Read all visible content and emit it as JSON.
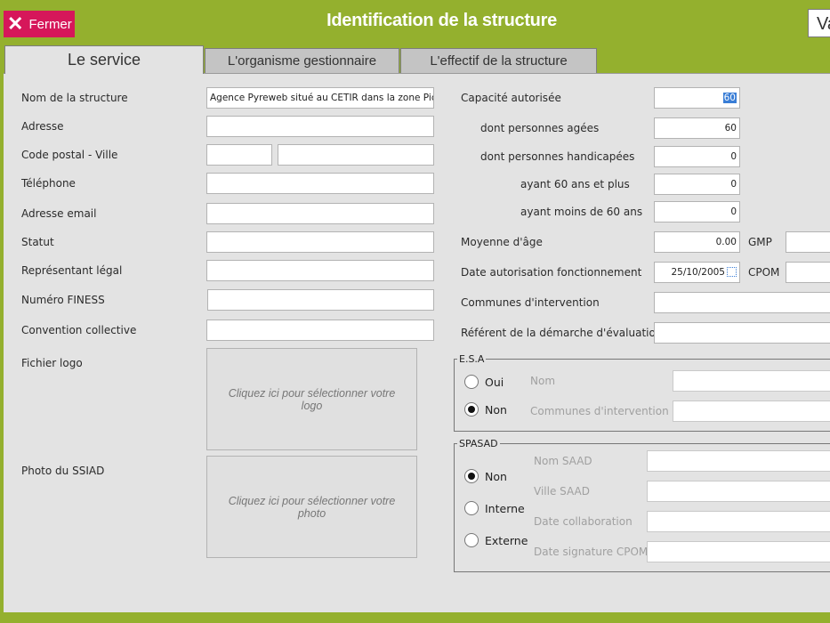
{
  "header": {
    "close_label": "Fermer",
    "title": "Identification de la structure",
    "validate_label": "Va"
  },
  "tabs": [
    {
      "label": "Le service",
      "active": true
    },
    {
      "label": "L'organisme gestionnaire",
      "active": false
    },
    {
      "label": "L'effectif de la structure",
      "active": false
    }
  ],
  "left": {
    "nom_structure": {
      "label": "Nom de la structure",
      "value": "Agence Pyreweb situé au CETIR dans la zone Pic Pyrén"
    },
    "adresse": {
      "label": "Adresse",
      "value": ""
    },
    "code_postal_ville": {
      "label": "Code postal -  Ville",
      "cp_value": "",
      "ville_value": ""
    },
    "telephone": {
      "label": "Téléphone",
      "value": ""
    },
    "email": {
      "label": "Adresse email",
      "value": ""
    },
    "statut": {
      "label": "Statut",
      "value": ""
    },
    "representant": {
      "label": "Représentant légal",
      "value": ""
    },
    "finess": {
      "label": "Numéro FINESS",
      "value": ""
    },
    "convention": {
      "label": "Convention collective",
      "value": ""
    },
    "logo": {
      "label": "Fichier logo",
      "placeholder": "Cliquez ici pour sélectionner votre logo"
    },
    "photo": {
      "label": "Photo du SSIAD",
      "placeholder": "Cliquez ici pour sélectionner votre photo"
    }
  },
  "right": {
    "capacite": {
      "label": "Capacité autorisée",
      "value": "60"
    },
    "personnes_agees": {
      "label": "dont personnes agées",
      "value": "60"
    },
    "personnes_handicapees": {
      "label": "dont personnes handicapées",
      "value": "0"
    },
    "ayant_60_plus": {
      "label": "ayant 60 ans et plus",
      "value": "0"
    },
    "ayant_moins_60": {
      "label": "ayant moins de 60 ans",
      "value": "0"
    },
    "moyenne_age": {
      "label": "Moyenne d'âge",
      "value": "0.00"
    },
    "gmp": {
      "label": "GMP",
      "value": ""
    },
    "date_autorisation": {
      "label": "Date autorisation fonctionnement",
      "value": "25/10/2005"
    },
    "cpom": {
      "label": "CPOM",
      "value": ""
    },
    "communes": {
      "label": "Communes d'intervention",
      "value": ""
    },
    "referent": {
      "label": "Référent de la démarche d'évaluation",
      "value": ""
    }
  },
  "esa": {
    "legend": "E.S.A",
    "options": [
      {
        "label": "Oui",
        "checked": false
      },
      {
        "label": "Non",
        "checked": true
      }
    ],
    "nom_label": "Nom",
    "nom_value": "",
    "communes_label": "Communes d'intervention",
    "communes_value": ""
  },
  "spasad": {
    "legend": "SPASAD",
    "options": [
      {
        "label": "Non",
        "checked": true
      },
      {
        "label": "Interne",
        "checked": false
      },
      {
        "label": "Externe",
        "checked": false
      }
    ],
    "nom_saad_label": "Nom SAAD",
    "ville_saad_label": "Ville SAAD",
    "date_collab_label": "Date collaboration",
    "date_cpom_label": "Date signature CPOM",
    "nom_saad_value": "",
    "ville_saad_value": "",
    "date_collab_value": "",
    "date_cpom_value": ""
  },
  "colors": {
    "background": "#94b02e",
    "close_button": "#d6175a",
    "panel": "#e3e3e3",
    "selection": "#3a7ed6"
  }
}
